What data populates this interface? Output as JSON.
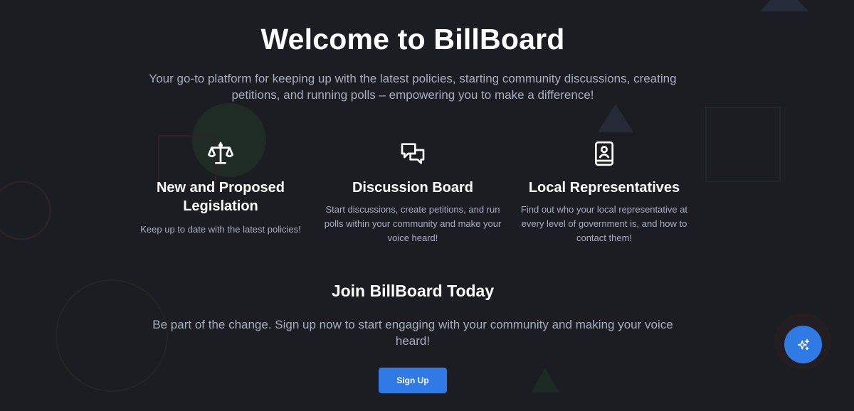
{
  "hero": {
    "title": "Welcome to BillBoard",
    "subtitle": "Your go-to platform for keeping up with the latest policies, starting community discussions, creating petitions, and running polls – empowering you to make a difference!"
  },
  "features": [
    {
      "icon": "scales-icon",
      "title": "New and Proposed Legislation",
      "description": "Keep up to date with the latest policies!"
    },
    {
      "icon": "chat-bubbles-icon",
      "title": "Discussion Board",
      "description": "Start discussions, create petitions, and run polls within your community and make your voice heard!"
    },
    {
      "icon": "contact-book-icon",
      "title": "Local Representatives",
      "description": "Find out who your local representative at every level of government is, and how to contact them!"
    }
  ],
  "join": {
    "title": "Join BillBoard Today",
    "description": "Be part of the change. Sign up now to start engaging with your community and making your voice heard!",
    "button_label": "Sign Up"
  },
  "fab": {
    "icon": "sparkles-icon"
  },
  "colors": {
    "background": "#1b1d22",
    "accent": "#2f7ae5",
    "muted_text": "#a7aec0"
  }
}
